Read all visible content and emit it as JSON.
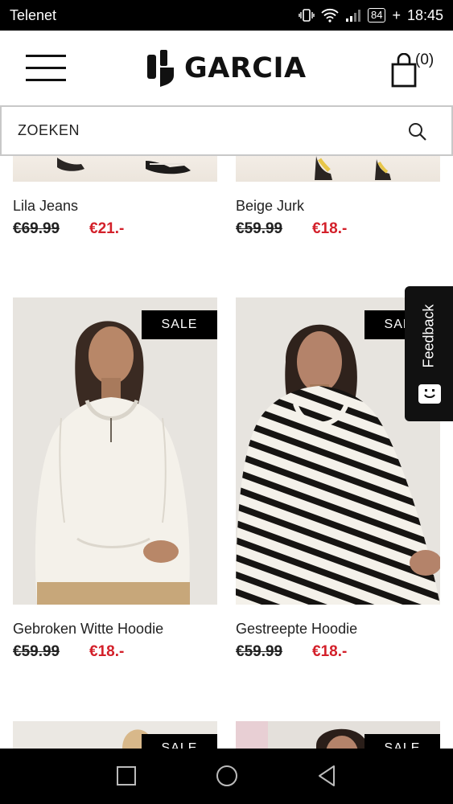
{
  "status_bar": {
    "carrier": "Telenet",
    "battery": "84",
    "time": "18:45"
  },
  "header": {
    "brand": "GARCIA",
    "cart_count": "(0)"
  },
  "search": {
    "placeholder": "ZOEKEN"
  },
  "products": [
    {
      "name": "Lila Jeans",
      "price_old": "€69.99",
      "price_new": "€21.-"
    },
    {
      "name": "Beige Jurk",
      "price_old": "€59.99",
      "price_new": "€18.-"
    },
    {
      "name": "Gebroken Witte Hoodie",
      "price_old": "€59.99",
      "price_new": "€18.-",
      "badge": "SALE"
    },
    {
      "name": "Gestreepte Hoodie",
      "price_old": "€59.99",
      "price_new": "€18.-",
      "badge": "SALE"
    },
    {
      "badge": "SALE"
    },
    {
      "badge": "SALE"
    }
  ],
  "feedback": {
    "label": "Feedback"
  },
  "colors": {
    "sale_price": "#d3202a",
    "badge_bg": "#000000",
    "feedback_bg": "#111111"
  }
}
